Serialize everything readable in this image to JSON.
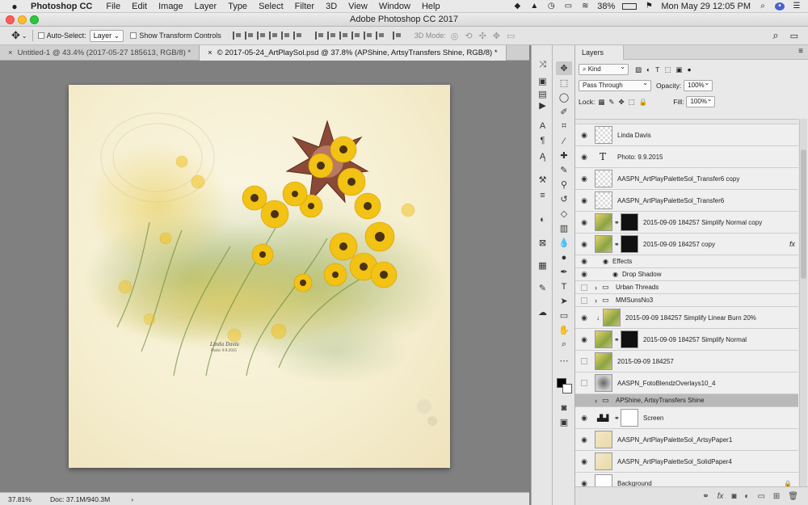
{
  "menubar": {
    "app_name": "Photoshop CC",
    "items": [
      "File",
      "Edit",
      "Image",
      "Layer",
      "Type",
      "Select",
      "Filter",
      "3D",
      "View",
      "Window",
      "Help"
    ],
    "battery": "38%",
    "clock": "Mon May 29  12:05 PM"
  },
  "window": {
    "title": "Adobe Photoshop CC 2017"
  },
  "options": {
    "auto_select_label": "Auto-Select:",
    "auto_select_value": "Layer",
    "show_transform_label": "Show Transform Controls",
    "mode_3d_label": "3D Mode:"
  },
  "tabs": [
    {
      "label": "Untitled-1 @ 43.4% (2017-05-27 185613, RGB/8) *",
      "active": false
    },
    {
      "label": "© 2017-05-24_ArtPlaySol.psd @ 37.8% (APShine, ArtsyTransfers Shine, RGB/8) *",
      "active": true
    }
  ],
  "status": {
    "zoom": "37.81%",
    "doc_info": "Doc: 37.1M/940.3M"
  },
  "artwork": {
    "signature_line1": "Linda Davis",
    "signature_line2": "Photo: 9.9.2015"
  },
  "layers_panel": {
    "tab_label": "Layers",
    "filter_kind": "Kind",
    "blend_mode": "Pass Through",
    "opacity_label": "Opacity:",
    "opacity_value": "100%",
    "lock_label": "Lock:",
    "fill_label": "Fill:",
    "fill_value": "100%",
    "layers": [
      {
        "name": "Linda Davis",
        "kind": "check",
        "visible": true
      },
      {
        "name": "Photo: 9.9.2015",
        "kind": "type",
        "visible": true
      },
      {
        "name": "AASPN_ArtPlayPaletteSol_Transfer6 copy",
        "kind": "check",
        "visible": true
      },
      {
        "name": "AASPN_ArtPlayPaletteSol_Transfer6",
        "kind": "check",
        "visible": true
      },
      {
        "name": "2015-09-09 184257 Simplify Normal copy",
        "kind": "photo-mask",
        "visible": true
      },
      {
        "name": "2015-09-09 184257 copy",
        "kind": "photo-mask",
        "visible": true,
        "fx": "fx"
      },
      {
        "name": "Effects",
        "kind": "effects",
        "visible": true
      },
      {
        "name": "Drop Shadow",
        "kind": "effect-item",
        "visible": true
      },
      {
        "name": "Urban Threads",
        "kind": "group",
        "visible": false
      },
      {
        "name": "MMSunsNo3",
        "kind": "group",
        "visible": false
      },
      {
        "name": "2015-09-09 184257 Simplify Linear Burn 20%",
        "kind": "photo-clip",
        "visible": true
      },
      {
        "name": "2015-09-09 184257 Simplify Normal",
        "kind": "photo-mask2",
        "visible": true
      },
      {
        "name": "2015-09-09 184257",
        "kind": "photo",
        "visible": false
      },
      {
        "name": "AASPN_FotoBlendzOverlays10_4",
        "kind": "overlay",
        "visible": false
      },
      {
        "name": "APShine, ArtsyTransfers Shine",
        "kind": "group-selected",
        "visible": false
      },
      {
        "name": "Screen",
        "kind": "levels",
        "visible": true
      },
      {
        "name": "AASPN_ArtPlayPaletteSol_ArtsyPaper1",
        "kind": "paper",
        "visible": true
      },
      {
        "name": "AASPN_ArtPlayPaletteSol_SolidPaper4",
        "kind": "paper",
        "visible": true
      },
      {
        "name": "Background",
        "kind": "white",
        "visible": true
      }
    ]
  }
}
